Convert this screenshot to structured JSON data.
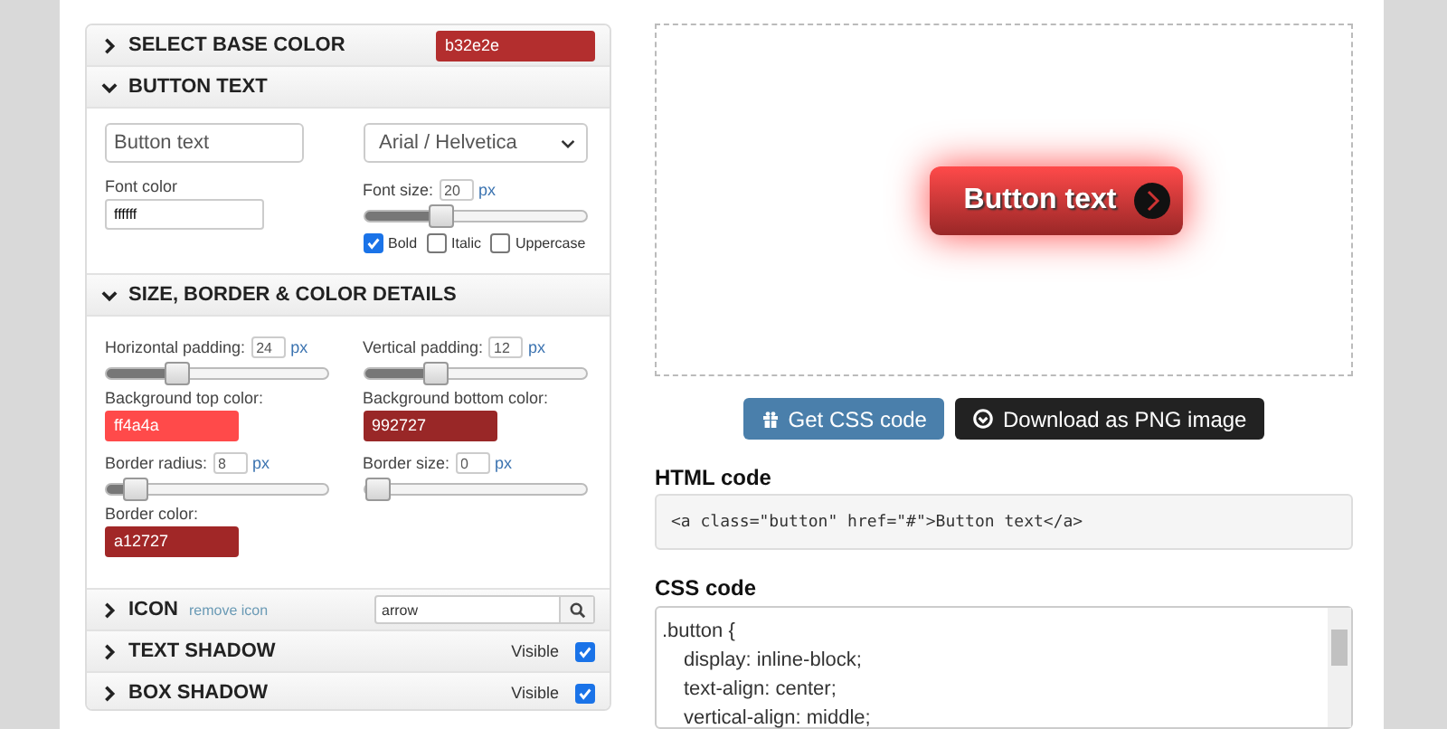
{
  "base_color": {
    "label": "SELECT BASE COLOR",
    "expanded": false,
    "value": "b32e2e",
    "color": "#b32e2e"
  },
  "button_text": {
    "label": "BUTTON TEXT",
    "expanded": true,
    "text_value": "Button text",
    "font_family": "Arial / Helvetica",
    "font_color_label": "Font color",
    "font_color_value": "ffffff",
    "font_size": {
      "label": "Font size:",
      "value": "20",
      "unit": "px",
      "level": 0.35
    },
    "styles": [
      {
        "label": "Bold",
        "checked": true
      },
      {
        "label": "Italic",
        "checked": false
      },
      {
        "label": "Uppercase",
        "checked": false
      }
    ]
  },
  "details": {
    "label": "SIZE, BORDER & COLOR DETAILS",
    "expanded": true,
    "sliders_top": [
      {
        "label": "Horizontal padding:",
        "value": "24",
        "unit": "px",
        "level": 0.3
      },
      {
        "label": "Vertical padding:",
        "value": "12",
        "unit": "px",
        "level": 0.3
      }
    ],
    "colors": [
      {
        "label": "Background top color:",
        "value": "ff4a4a",
        "color": "#ff4a4a"
      },
      {
        "label": "Background bottom color:",
        "value": "992727",
        "color": "#992727"
      }
    ],
    "sliders_bottom": [
      {
        "label": "Border radius:",
        "value": "8",
        "unit": "px",
        "level": 0.08
      },
      {
        "label": "Border size:",
        "value": "0",
        "unit": "px",
        "level": 0
      }
    ],
    "border_color": {
      "label": "Border color:",
      "value": "a12727",
      "color": "#a12727"
    }
  },
  "sections": [
    {
      "kind": "icon",
      "label": "ICON",
      "expanded": false,
      "link": "remove icon",
      "search_value": "arrow"
    },
    {
      "kind": "visible",
      "label": "TEXT SHADOW",
      "expanded": false,
      "visible_label": "Visible",
      "checked": true
    },
    {
      "kind": "visible",
      "label": "BOX SHADOW",
      "expanded": false,
      "visible_label": "Visible",
      "checked": true
    }
  ],
  "preview": {
    "button_label": "Button text"
  },
  "actions": [
    {
      "kind": "primary",
      "label": "Get CSS code"
    },
    {
      "kind": "dark",
      "label": "Download as PNG image"
    }
  ],
  "html_code": {
    "title": "HTML code",
    "code": "<a class=\"button\" href=\"#\">Button text</a>"
  },
  "css_code": {
    "title": "CSS code",
    "lines": [
      ".button {",
      "display: inline-block;",
      "text-align: center;",
      "vertical-align: middle;"
    ]
  }
}
